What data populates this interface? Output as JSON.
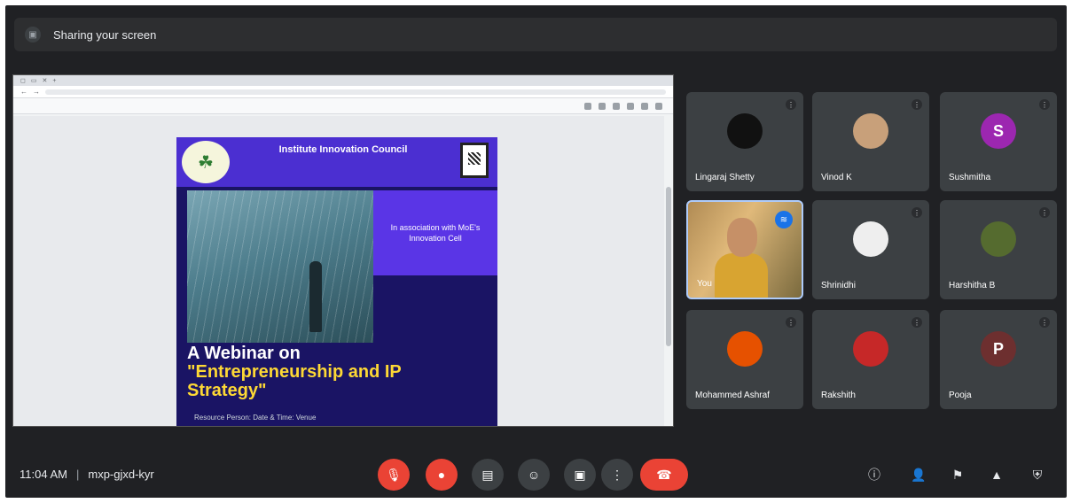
{
  "topbar": {
    "presenting_text": "Sharing your screen"
  },
  "poster": {
    "header_title": "Institute Innovation Council",
    "side_text": "In association with MoE's Innovation Cell",
    "headline_1": "A Webinar on",
    "headline_2": "\"Entrepreneurship and IP",
    "headline_3": "Strategy\"",
    "footer": "Resource Person: Date & Time: Venue"
  },
  "participants": [
    {
      "name": "Lingaraj Shetty",
      "avatar_color": "#111111",
      "initial": ""
    },
    {
      "name": "Vinod K",
      "avatar_color": "#c8a07a",
      "initial": ""
    },
    {
      "name": "Sushmitha",
      "avatar_color": "#9c27b0",
      "initial": "S"
    },
    {
      "name": "You",
      "video": true
    },
    {
      "name": "Shrinidhi",
      "avatar_color": "#eeeeee",
      "initial": ""
    },
    {
      "name": "Harshitha B",
      "avatar_color": "#556b2f",
      "initial": ""
    },
    {
      "name": "Mohammed Ashraf",
      "avatar_color": "#e65100",
      "initial": ""
    },
    {
      "name": "Rakshith",
      "avatar_color": "#c62828",
      "initial": ""
    },
    {
      "name": "Pooja",
      "avatar_color": "#6d2f2f",
      "initial": "P"
    }
  ],
  "meta": {
    "time": "11:04 AM",
    "meeting_code": "mxp-gjxd-kyr"
  },
  "controls": {
    "mic_icon": "mic-off-icon",
    "cam_icon": "camera-off-icon",
    "captions_icon": "captions-icon",
    "emoji_icon": "emoji-icon",
    "present_icon": "present-icon",
    "more_icon": "more-icon",
    "end_icon": "end-call-icon"
  }
}
